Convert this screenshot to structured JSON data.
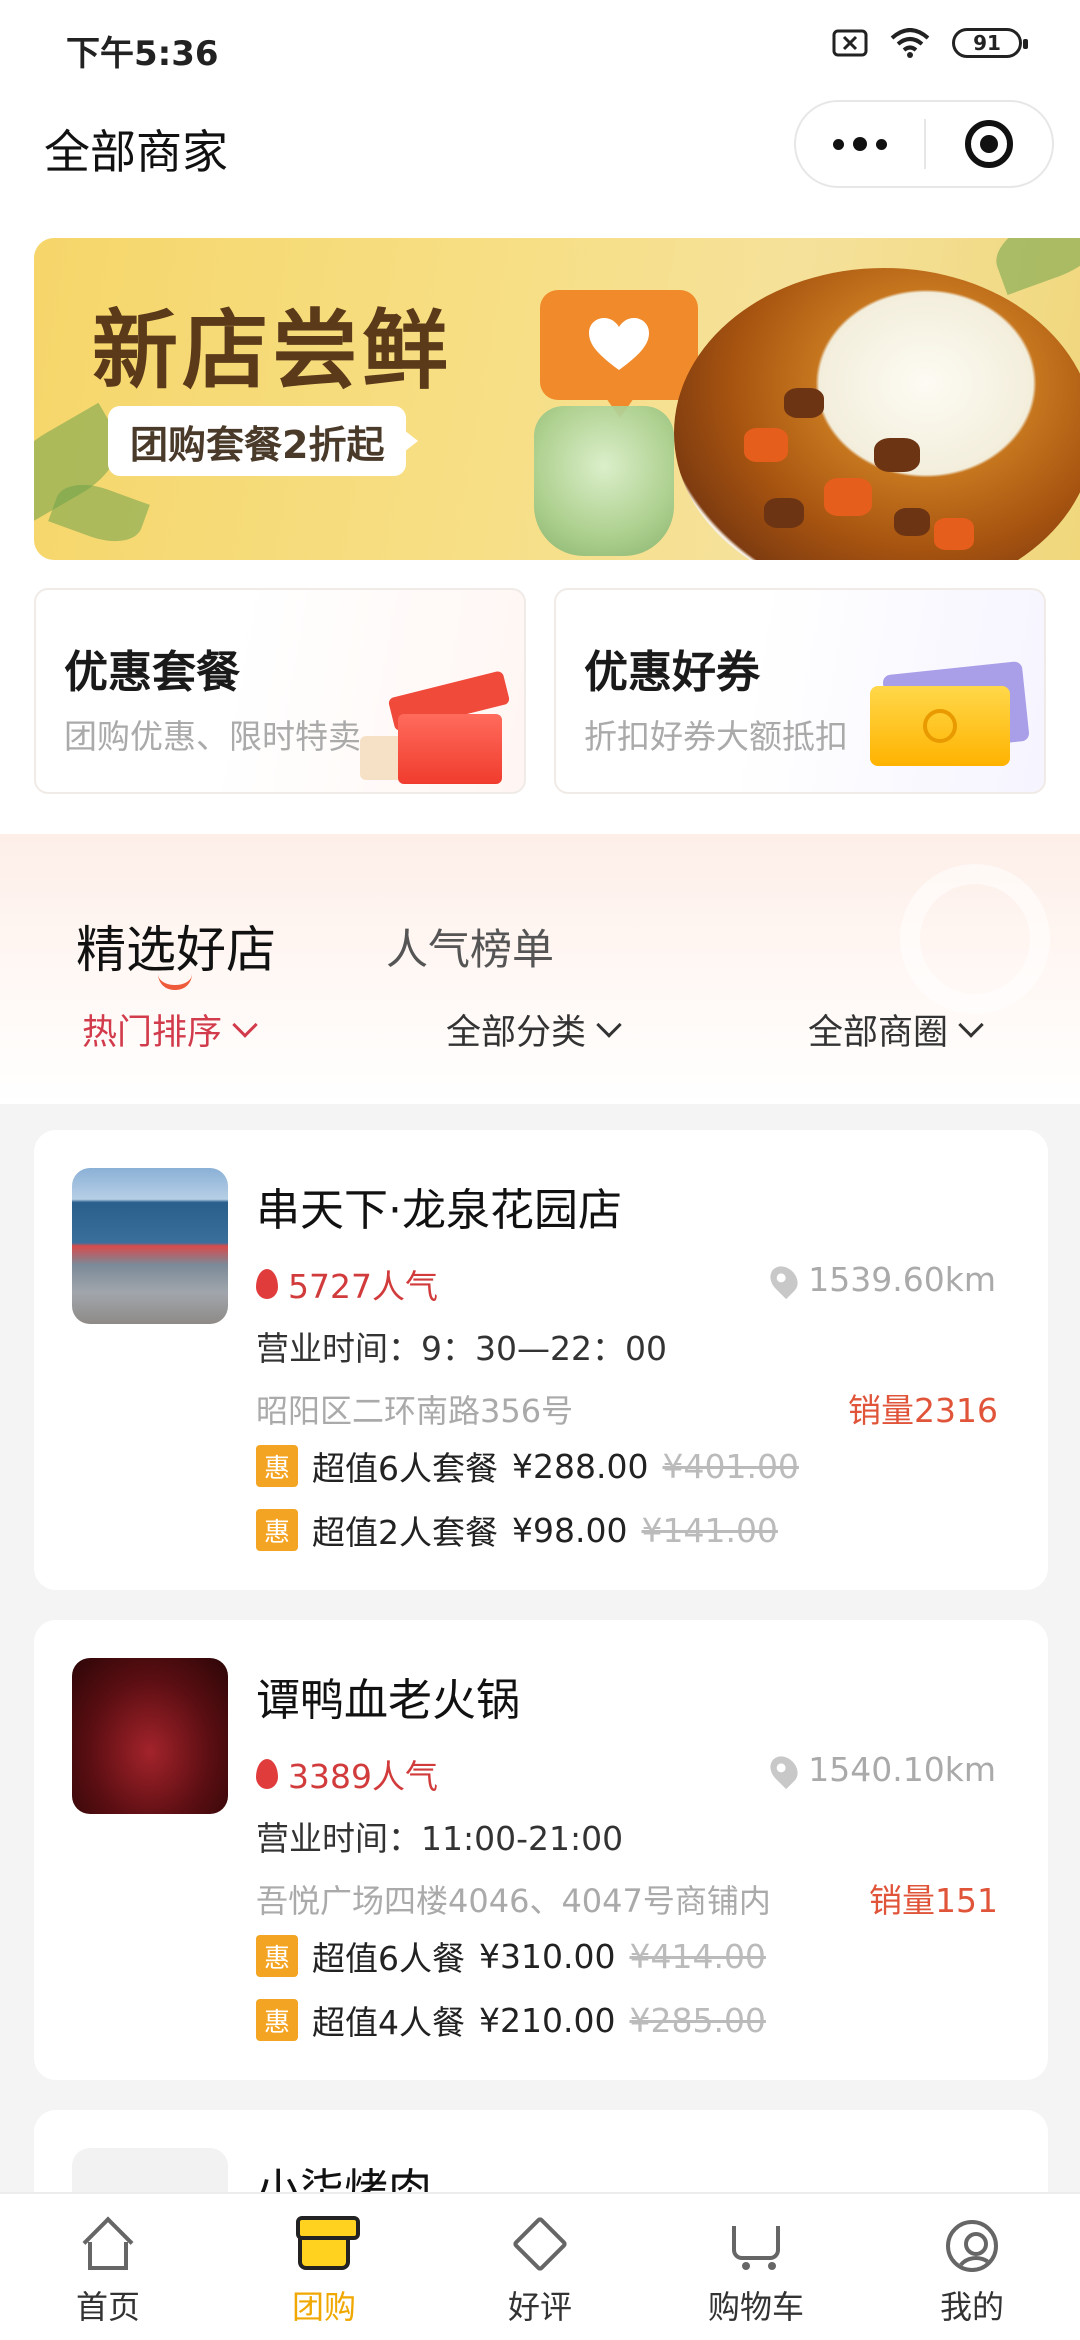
{
  "status_bar": {
    "time": "下午5:36",
    "battery": "91"
  },
  "header": {
    "title": "全部商家"
  },
  "banner": {
    "title": "新店尝鲜",
    "subtitle": "团购套餐2折起"
  },
  "promos": [
    {
      "title": "优惠套餐",
      "subtitle": "团购优惠、限时特卖"
    },
    {
      "title": "优惠好券",
      "subtitle": "折扣好券大额抵扣"
    }
  ],
  "tabs": [
    {
      "label": "精选好店"
    },
    {
      "label": "人气榜单"
    }
  ],
  "filters": [
    {
      "label": "热门排序"
    },
    {
      "label": "全部分类"
    },
    {
      "label": "全部商圈"
    }
  ],
  "stores": [
    {
      "name": "串天下·龙泉花园店",
      "popularity": "5727人气",
      "distance": "1539.60km",
      "hours": "营业时间：9：30—22：00",
      "address": "昭阳区二环南路356号",
      "sales": "销量2316",
      "deals": [
        {
          "badge": "惠",
          "name": "超值6人套餐",
          "price": "¥288.00",
          "original": "¥401.00"
        },
        {
          "badge": "惠",
          "name": "超值2人套餐",
          "price": "¥98.00",
          "original": "¥141.00"
        }
      ]
    },
    {
      "name": "谭鸭血老火锅",
      "popularity": "3389人气",
      "distance": "1540.10km",
      "hours": "营业时间：11:00-21:00",
      "address": "吾悦广场四楼4046、4047号商铺内",
      "sales": "销量151",
      "deals": [
        {
          "badge": "惠",
          "name": "超值6人餐",
          "price": "¥310.00",
          "original": "¥414.00"
        },
        {
          "badge": "惠",
          "name": "超值4人餐",
          "price": "¥210.00",
          "original": "¥285.00"
        }
      ]
    },
    {
      "name": "小柒烤肉"
    }
  ],
  "bottom_nav": [
    {
      "label": "首页"
    },
    {
      "label": "团购",
      "active": true
    },
    {
      "label": "好评"
    },
    {
      "label": "购物车"
    },
    {
      "label": "我的"
    }
  ],
  "colors": {
    "accent_red": "#d23b4b",
    "sales_orange": "#e0553a",
    "deal_badge": "#f4a423",
    "nav_active": "#f0a800"
  }
}
